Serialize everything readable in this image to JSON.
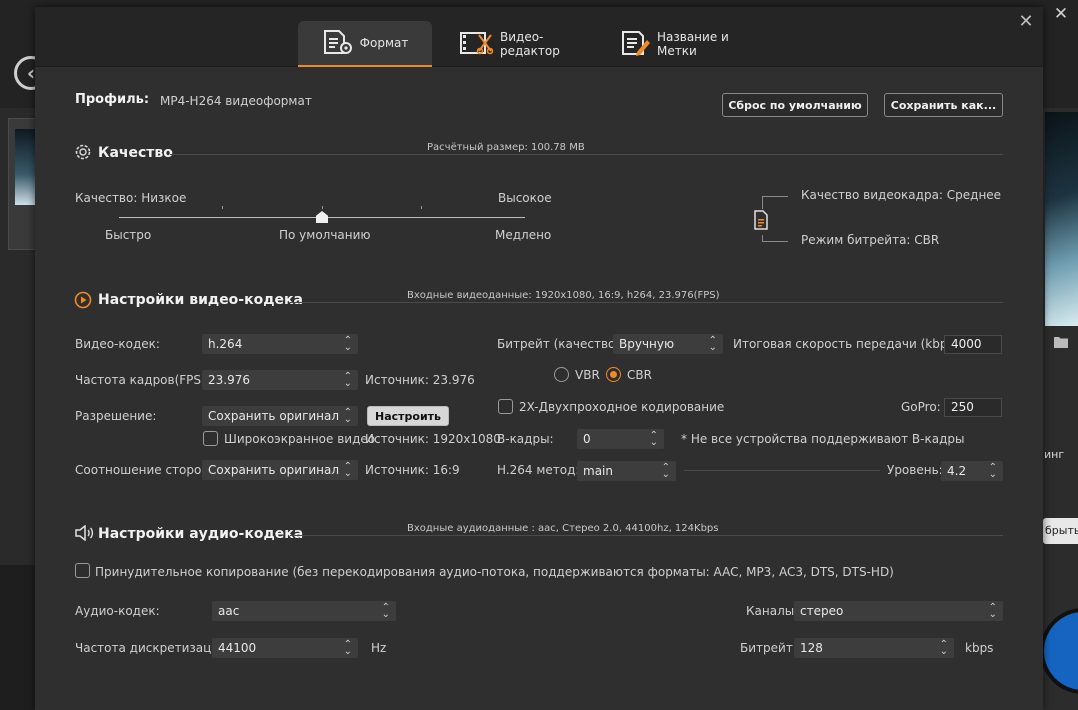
{
  "tabs": [
    {
      "label": "Формат",
      "icon": "format-icon",
      "active": true
    },
    {
      "label": "Видео-редактор",
      "icon": "video-editor-icon",
      "active": false
    },
    {
      "label": "Название и Метки",
      "icon": "title-tags-icon",
      "active": false
    }
  ],
  "profile": {
    "label": "Профиль:",
    "value": "MP4-H264 видеоформат",
    "reset_button": "Сброс по умолчанию",
    "save_button": "Сохранить как..."
  },
  "quality": {
    "title": "Качество",
    "estimated_size": "Расчётный размер: 100.78 MB",
    "low_label": "Качество: Низкое",
    "high_label": "Высокое",
    "fast_label": "Быстро",
    "default_label": "По умолчанию",
    "slow_label": "Медлено",
    "frame_quality": "Качество видеокадра: Среднее",
    "bitrate_mode": "Режим битрейта: CBR",
    "slider_level": 0.5
  },
  "video": {
    "title": "Настройки видео-кодека",
    "input_info": "Входные видеоданные: 1920x1080, 16:9, h264, 23.976(FPS)",
    "codec_label": "Видео-кодек:",
    "codec_value": "h.264",
    "fps_label": "Частота кадров(FPS):",
    "fps_value": "23.976",
    "fps_source": "Источник: 23.976",
    "resolution_label": "Разрешение:",
    "resolution_value": "Сохранить оригинал",
    "configure_button": "Настроить",
    "widescreen_label": "Широкоэкранное видео",
    "resolution_source": "Источник: 1920x1080",
    "aspect_label": "Соотношение сторон:",
    "aspect_value": "Сохранить оригинал",
    "aspect_source": "Источник: 16:9",
    "bitrate_label": "Битрейт (качество):",
    "bitrate_value": "Вручную",
    "total_rate_label": "Итоговая скорость передачи (kbps):",
    "total_rate_value": "4000",
    "vbr_label": "VBR",
    "cbr_label": "CBR",
    "twopass_label": "2X-Двухпроходное кодирование",
    "gopro_label": "GoPro:",
    "gopro_value": "250",
    "bframes_label": "B-кадры:",
    "bframes_value": "0",
    "bframes_note": "* Не все устройства поддерживают B-кадры",
    "method_label": "H.264 метод:",
    "method_value": "main",
    "level_label": "Уровень:",
    "level_value": "4.2"
  },
  "audio": {
    "title": "Настройки аудио-кодека",
    "input_info": "Входные аудиоданные : aac, Стерео 2.0, 44100hz, 124Kbps",
    "force_copy_label": "Принудительное копирование (без перекодирования аудио-потока, поддерживаются форматы: AAC, MP3, AC3, DTS, DTS-HD)",
    "codec_label": "Аудио-кодек:",
    "codec_value": "aac",
    "sample_rate_label": "Частота дискретизации:",
    "sample_rate_value": "44100",
    "sample_rate_unit": "Hz",
    "channels_label": "Каналы:",
    "channels_value": "стерео",
    "bitrate_label": "Битрейт:",
    "bitrate_value": "128",
    "bitrate_unit": "kbps"
  },
  "background": {
    "right_text": "инг",
    "right_button": "брыть"
  },
  "colors": {
    "accent": "#f08a28",
    "dialog_bg": "#2f2f2f"
  }
}
